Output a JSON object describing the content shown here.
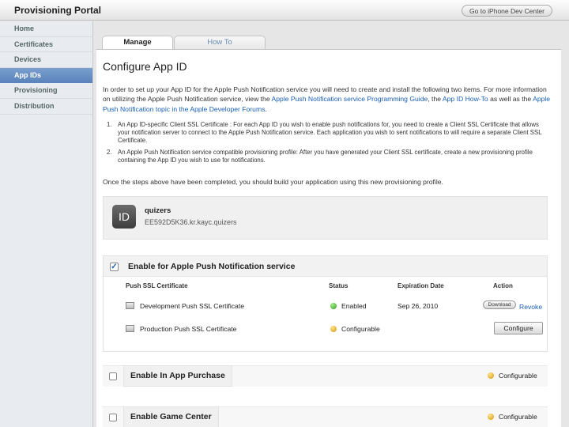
{
  "header": {
    "title": "Provisioning Portal",
    "dev_center_label": "Go to iPhone Dev Center"
  },
  "sidebar": {
    "items": [
      {
        "label": "Home"
      },
      {
        "label": "Certificates"
      },
      {
        "label": "Devices"
      },
      {
        "label": "App IDs",
        "active": true
      },
      {
        "label": "Provisioning"
      },
      {
        "label": "Distribution"
      }
    ]
  },
  "tabs": [
    {
      "label": "Manage",
      "active": true
    },
    {
      "label": "How To"
    }
  ],
  "page": {
    "title": "Configure App ID",
    "intro_1": "In order to set up your App ID for the Apple Push Notification service you will need to create and install the following two items. For more information on utilizing the Apple Push Notification service, view the ",
    "intro_link_1": "Apple Push Notification service Programming Guide",
    "intro_2": ", the ",
    "intro_link_2": "App ID How-To",
    "intro_3": " as well as the ",
    "intro_link_3": "Apple Push Notification topic in the Apple Developer Forums",
    "intro_4": ".",
    "steps": [
      {
        "num": "1.",
        "text": "An App ID-specific Client SSL Certificate : For each App ID you wish to enable push notifications for, you need to create a Client SSL Certificate that allows your notification server to connect to the Apple Push Notification service. Each application you wish to sent notifications to will require a separate Client SSL Certificate."
      },
      {
        "num": "2.",
        "text": "An Apple Push Notification service compatible provisioning profile: After you have generated your Client SSL certificate, create a new provisioning profile containing the App ID you wish to use for notifications."
      }
    ],
    "after_steps": "Once the steps above have been completed, you should build your application using this new provisioning profile."
  },
  "app_id": {
    "icon_text": "ID",
    "name": "quizers",
    "bundle": "EE592D5K36.kr.kayc.quizers"
  },
  "push": {
    "enabled": true,
    "title": "Enable for Apple Push Notification service",
    "columns": {
      "cert": "Push SSL Certificate",
      "status": "Status",
      "expiration": "Expiration Date",
      "action": "Action"
    },
    "rows": [
      {
        "name": "Development Push SSL Certificate",
        "status": "Enabled",
        "status_color": "#2f9c1c",
        "expiration": "Sep 26, 2010",
        "download_label": "Download",
        "revoke_label": "Revoke"
      },
      {
        "name": "Production Push SSL Certificate",
        "status": "Configurable",
        "status_color": "#d99a10",
        "expiration": "",
        "configure_label": "Configure"
      }
    ]
  },
  "features": [
    {
      "label": "Enable In App Purchase",
      "status": "Configurable",
      "checked": false
    },
    {
      "label": "Enable Game Center",
      "status": "Configurable",
      "checked": false
    }
  ]
}
